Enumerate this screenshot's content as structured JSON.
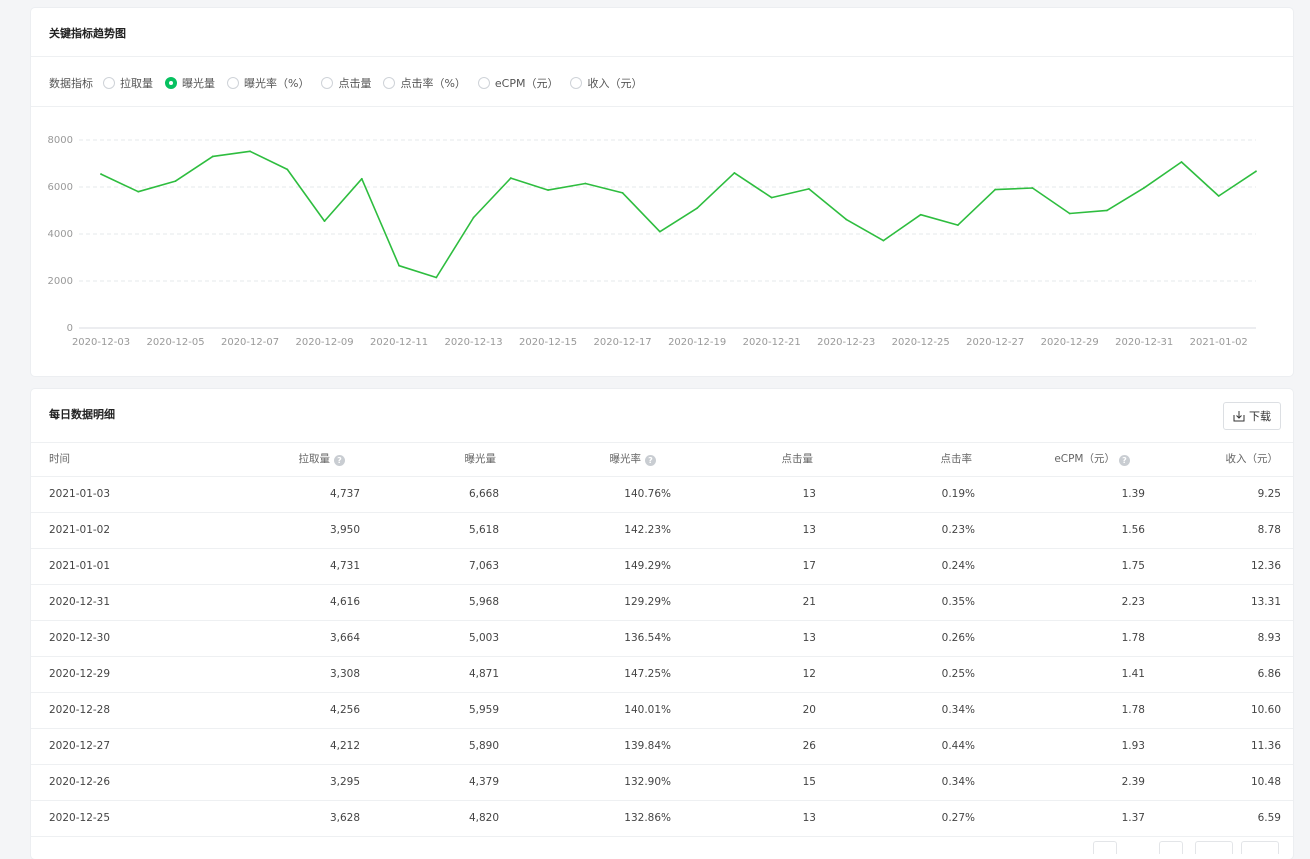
{
  "trend": {
    "title": "关键指标趋势图",
    "metric_label": "数据指标",
    "metrics": [
      {
        "label": "拉取量",
        "checked": false
      },
      {
        "label": "曝光量",
        "checked": true
      },
      {
        "label": "曝光率（%）",
        "checked": false
      },
      {
        "label": "点击量",
        "checked": false
      },
      {
        "label": "点击率（%）",
        "checked": false
      },
      {
        "label": "eCPM（元）",
        "checked": false
      },
      {
        "label": "收入（元）",
        "checked": false
      }
    ]
  },
  "chart_data": {
    "type": "line",
    "x": [
      "2020-12-03",
      "2020-12-04",
      "2020-12-05",
      "2020-12-06",
      "2020-12-07",
      "2020-12-08",
      "2020-12-09",
      "2020-12-10",
      "2020-12-11",
      "2020-12-12",
      "2020-12-13",
      "2020-12-14",
      "2020-12-15",
      "2020-12-16",
      "2020-12-17",
      "2020-12-18",
      "2020-12-19",
      "2020-12-20",
      "2020-12-21",
      "2020-12-22",
      "2020-12-23",
      "2020-12-24",
      "2020-12-25",
      "2020-12-26",
      "2020-12-27",
      "2020-12-28",
      "2020-12-29",
      "2020-12-30",
      "2020-12-31",
      "2021-01-01",
      "2021-01-02",
      "2021-01-03"
    ],
    "x_tick_labels": [
      "2020-12-03",
      "2020-12-05",
      "2020-12-07",
      "2020-12-09",
      "2020-12-11",
      "2020-12-13",
      "2020-12-15",
      "2020-12-17",
      "2020-12-19",
      "2020-12-21",
      "2020-12-23",
      "2020-12-25",
      "2020-12-27",
      "2020-12-29",
      "2020-12-31",
      "2021-01-02"
    ],
    "y_ticks": [
      0,
      2000,
      4000,
      6000,
      8000
    ],
    "ylim": [
      0,
      8000
    ],
    "series": [
      {
        "values": [
          6550,
          5800,
          6250,
          7300,
          7520,
          6750,
          4550,
          6350,
          2650,
          2150,
          4700,
          6380,
          5870,
          6150,
          5750,
          4100,
          5100,
          6600,
          5550,
          5920,
          4620,
          3720,
          4820,
          4379,
          5890,
          5959,
          4871,
          5003,
          5968,
          7063,
          5618,
          6668
        ]
      }
    ],
    "color": "#2ebd3f",
    "grid": true
  },
  "detail": {
    "title": "每日数据明细",
    "download_label": "下载",
    "columns": [
      "时间",
      "拉取量",
      "曝光量",
      "曝光率",
      "点击量",
      "点击率",
      "eCPM（元）",
      "收入（元）"
    ],
    "rows": [
      [
        "2021-01-03",
        "4,737",
        "6,668",
        "140.76%",
        "13",
        "0.19%",
        "1.39",
        "9.25"
      ],
      [
        "2021-01-02",
        "3,950",
        "5,618",
        "142.23%",
        "13",
        "0.23%",
        "1.56",
        "8.78"
      ],
      [
        "2021-01-01",
        "4,731",
        "7,063",
        "149.29%",
        "17",
        "0.24%",
        "1.75",
        "12.36"
      ],
      [
        "2020-12-31",
        "4,616",
        "5,968",
        "129.29%",
        "21",
        "0.35%",
        "2.23",
        "13.31"
      ],
      [
        "2020-12-30",
        "3,664",
        "5,003",
        "136.54%",
        "13",
        "0.26%",
        "1.78",
        "8.93"
      ],
      [
        "2020-12-29",
        "3,308",
        "4,871",
        "147.25%",
        "12",
        "0.25%",
        "1.41",
        "6.86"
      ],
      [
        "2020-12-28",
        "4,256",
        "5,959",
        "140.01%",
        "20",
        "0.34%",
        "1.78",
        "10.60"
      ],
      [
        "2020-12-27",
        "4,212",
        "5,890",
        "139.84%",
        "26",
        "0.44%",
        "1.93",
        "11.36"
      ],
      [
        "2020-12-26",
        "3,295",
        "4,379",
        "132.90%",
        "15",
        "0.34%",
        "2.39",
        "10.48"
      ],
      [
        "2020-12-25",
        "3,628",
        "4,820",
        "132.86%",
        "13",
        "0.27%",
        "1.37",
        "6.59"
      ]
    ]
  }
}
